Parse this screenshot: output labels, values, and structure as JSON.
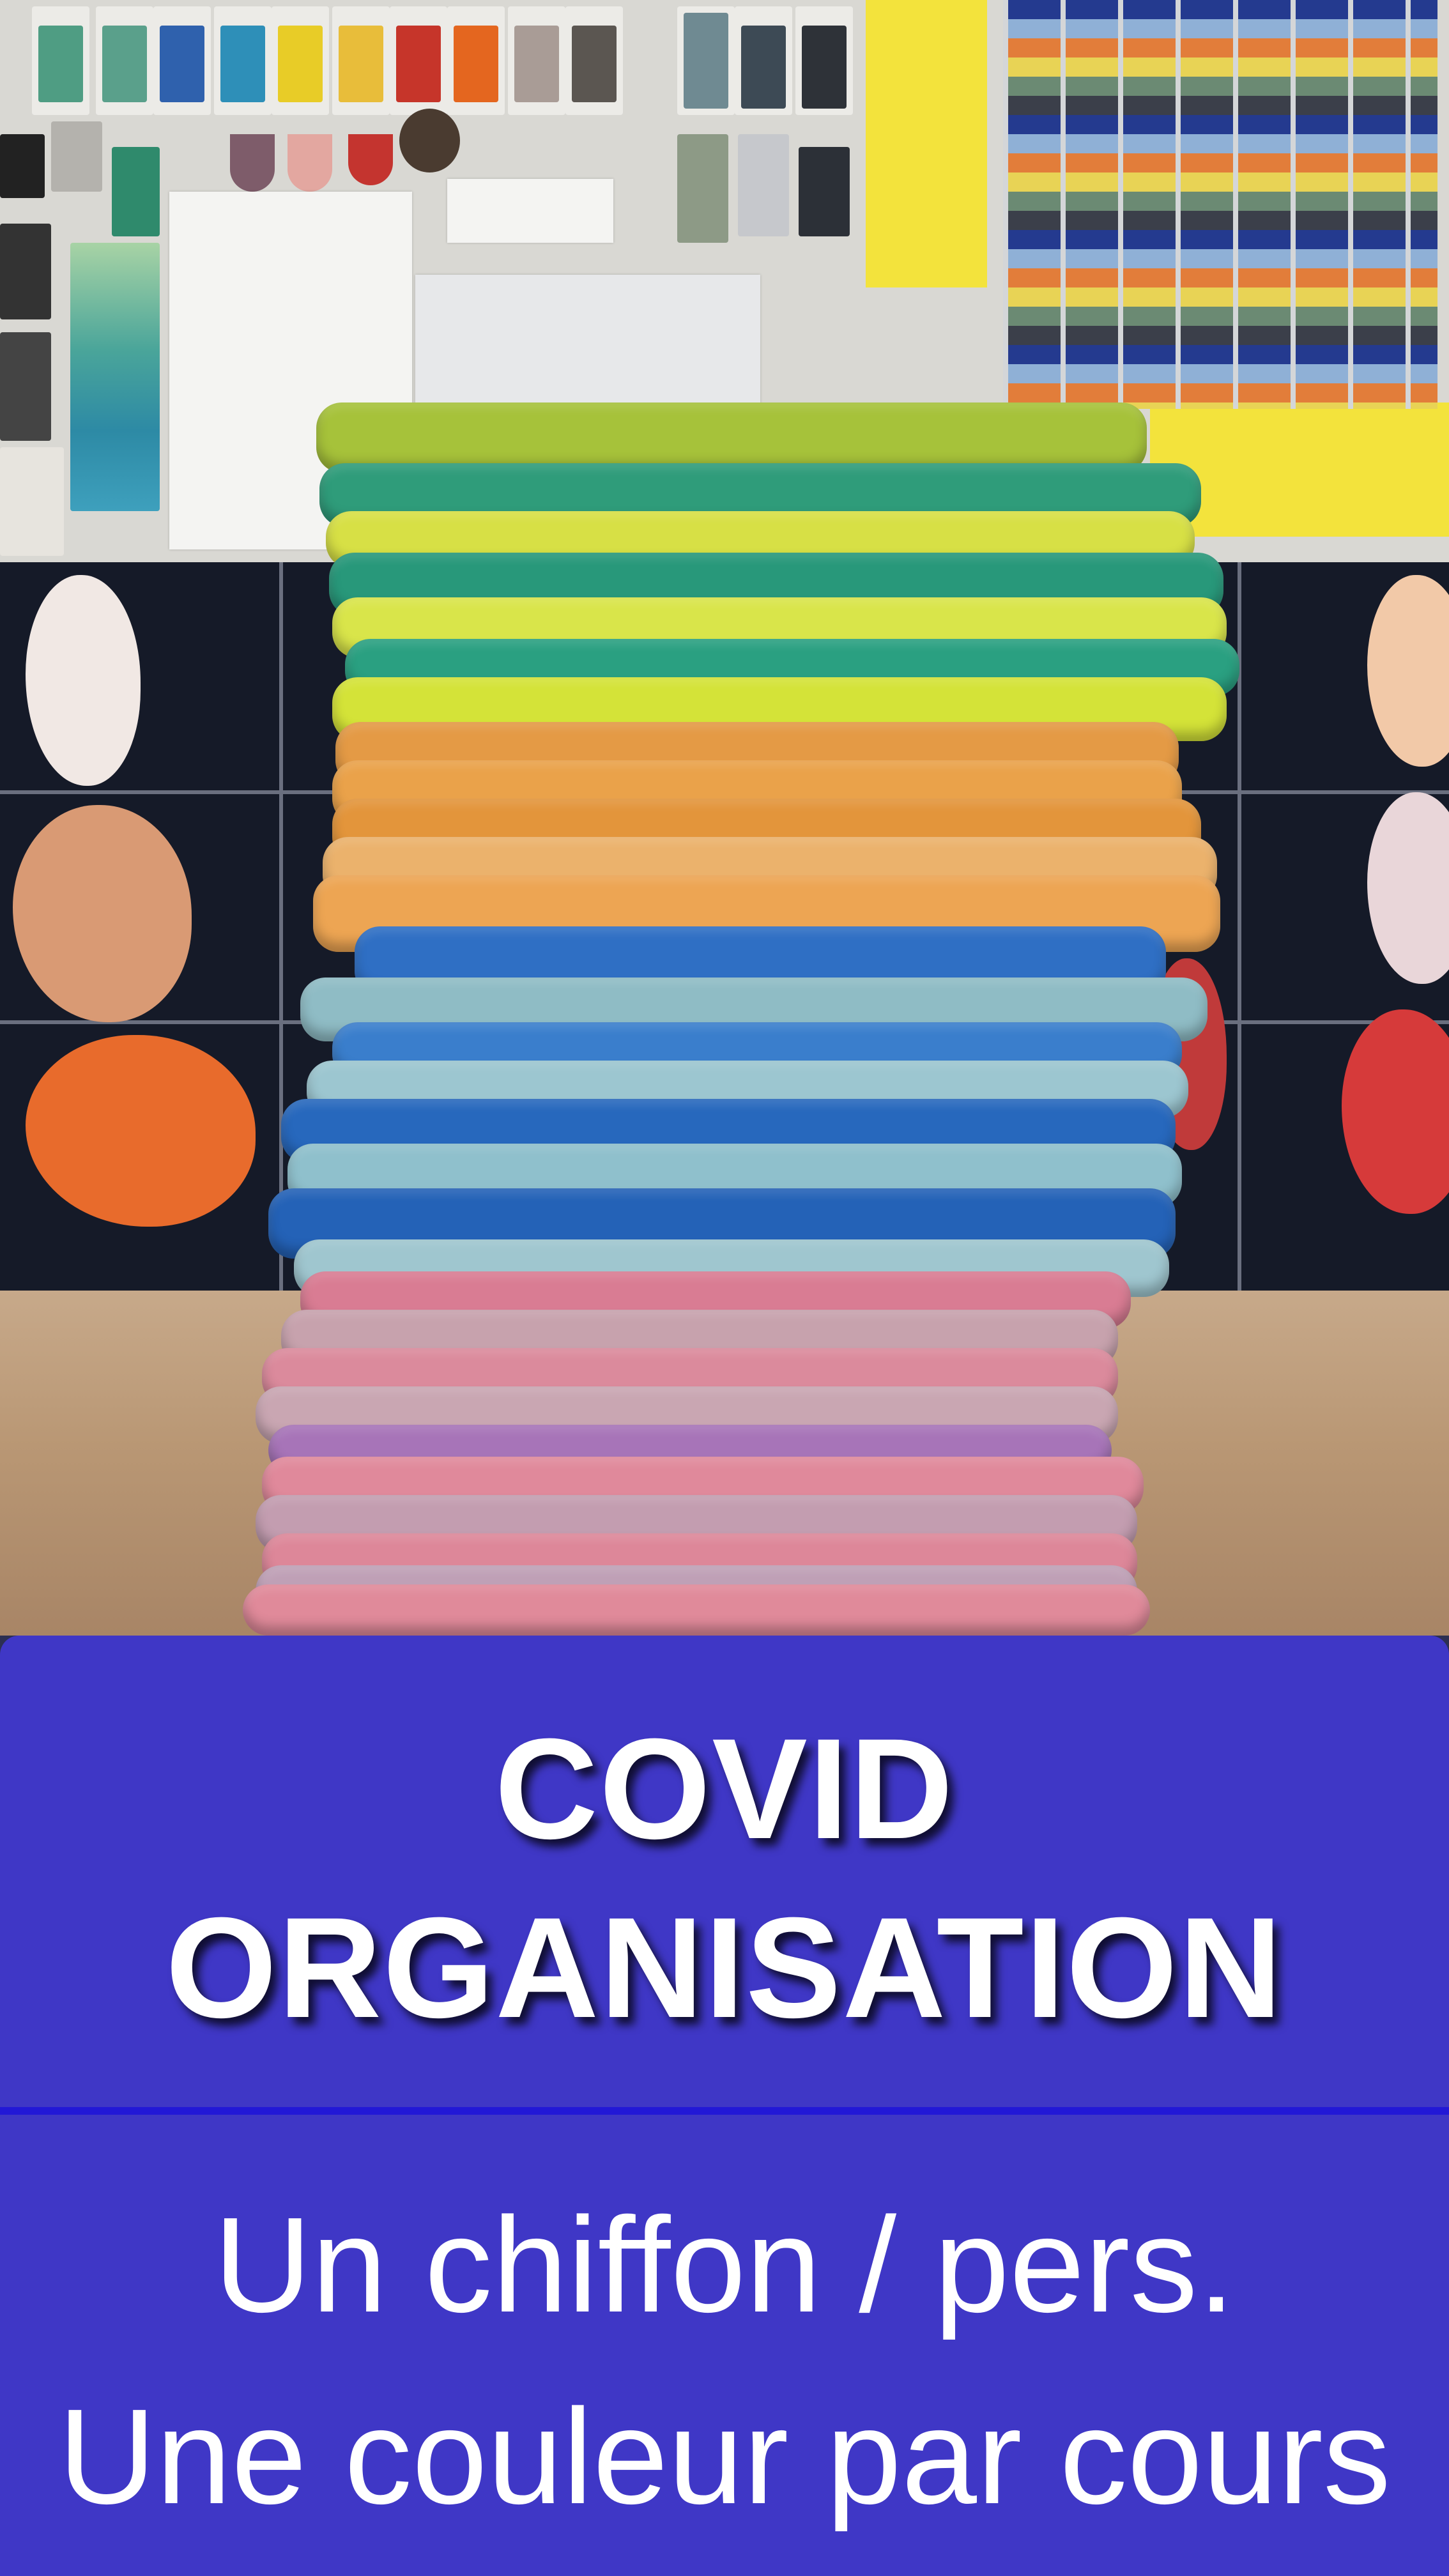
{
  "banner": {
    "title_line1": "COVID",
    "title_line2": "ORGANISATION",
    "subtitle_line1": "Un chiffon / pers.",
    "subtitle_line2": "Une couleur par cours"
  },
  "colors": {
    "banner_background": "#3f37c6",
    "divider": "#2218d6",
    "text": "#ffffff"
  },
  "photo": {
    "subject": "stack-of-cleaning-cloths"
  }
}
